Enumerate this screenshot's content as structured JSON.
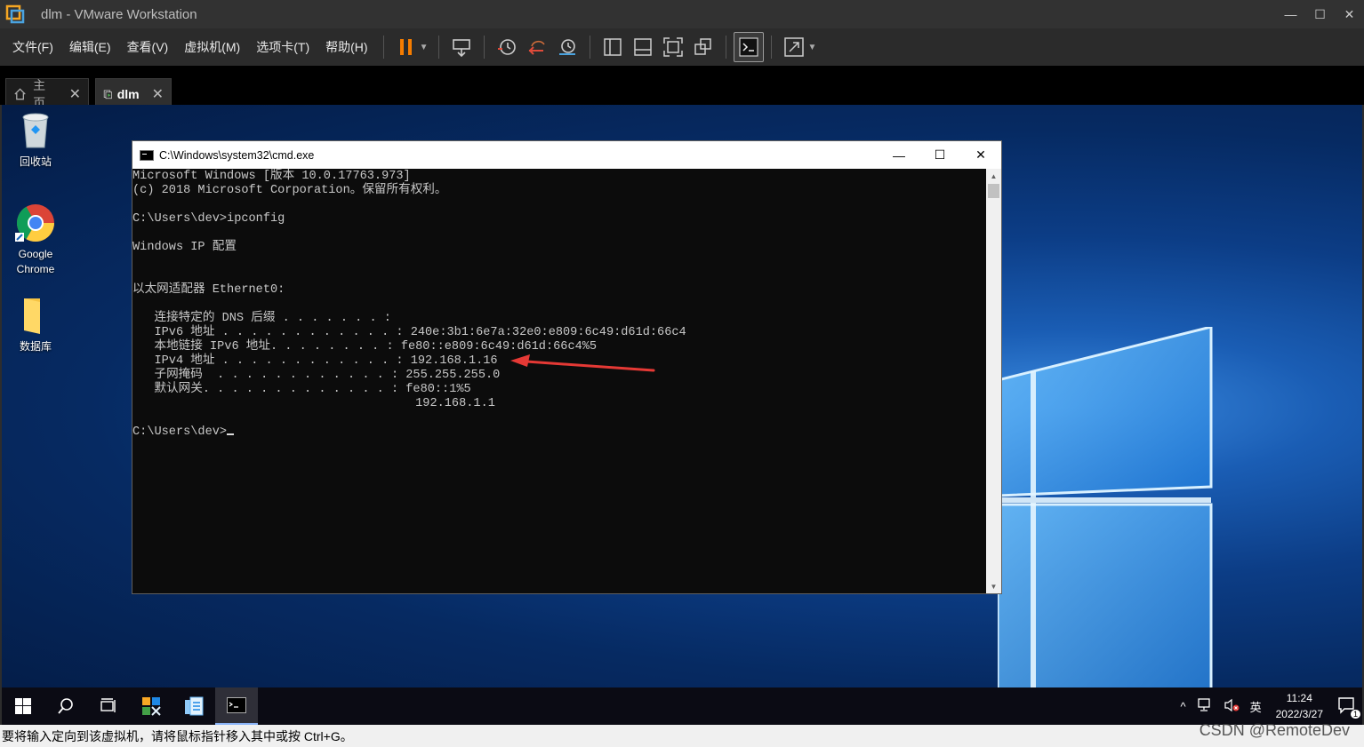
{
  "window": {
    "title": "dlm - VMware Workstation",
    "controls": [
      "—",
      "☐",
      "✕"
    ]
  },
  "menu": {
    "file": "文件(F)",
    "edit": "编辑(E)",
    "view": "查看(V)",
    "vm": "虚拟机(M)",
    "tabs": "选项卡(T)",
    "help": "帮助(H)"
  },
  "tabs": [
    {
      "label": "主页",
      "icon": "home-icon"
    },
    {
      "label": "dlm",
      "icon": "vm-icon"
    }
  ],
  "desktop_icons": [
    {
      "label": "回收站",
      "icon": "recycle-bin-icon"
    },
    {
      "label": "Google Chrome",
      "icon": "chrome-icon"
    },
    {
      "label": "数据库",
      "icon": "folder-icon"
    }
  ],
  "cmd": {
    "title": "C:\\Windows\\system32\\cmd.exe",
    "lines": [
      "Microsoft Windows [版本 10.0.17763.973]",
      "(c) 2018 Microsoft Corporation。保留所有权利。",
      "",
      "C:\\Users\\dev>ipconfig",
      "",
      "Windows IP 配置",
      "",
      "",
      "以太网适配器 Ethernet0:",
      "",
      "   连接特定的 DNS 后缀 . . . . . . . :",
      "   IPv6 地址 . . . . . . . . . . . . : 240e:3b1:6e7a:32e0:e809:6c49:d61d:66c4",
      "   本地链接 IPv6 地址. . . . . . . . : fe80::e809:6c49:d61d:66c4%5",
      "   IPv4 地址 . . . . . . . . . . . . : 192.168.1.16",
      "   子网掩码  . . . . . . . . . . . . : 255.255.255.0",
      "   默认网关. . . . . . . . . . . . . : fe80::1%5",
      "                                       192.168.1.1",
      "",
      "C:\\Users\\dev>"
    ]
  },
  "tray": {
    "chevron": "^",
    "ime": "英",
    "time": "11:24",
    "date": "2022/3/27",
    "notification_count": "1"
  },
  "statusbar": {
    "text": "要将输入定向到该虚拟机，请将鼠标指针移入其中或按 Ctrl+G。"
  },
  "watermark": "CSDN @RemoteDev",
  "colors": {
    "accent_pause": "#f57c00",
    "annotation_arrow": "#e53935"
  }
}
